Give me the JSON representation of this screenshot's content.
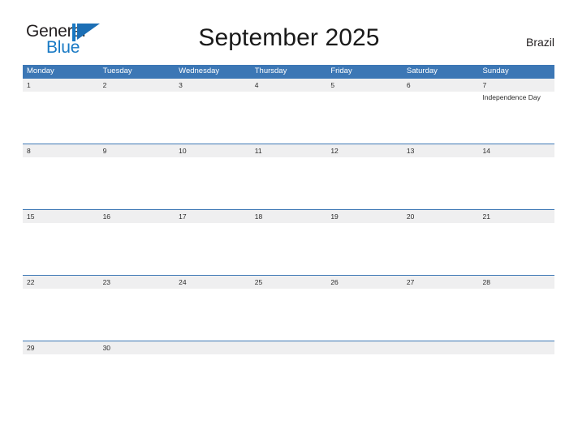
{
  "brand": {
    "line1": "General",
    "line2": "Blue",
    "mark": "flag-triangle-icon",
    "color_dark": "#231f20",
    "color_blue": "#1879c4"
  },
  "header": {
    "title": "September 2025",
    "country": "Brazil"
  },
  "theme": {
    "header_blue": "#3c77b5",
    "date_band": "#efeff0",
    "text": "#2b2b2b"
  },
  "calendar": {
    "weekdays": [
      "Monday",
      "Tuesday",
      "Wednesday",
      "Thursday",
      "Friday",
      "Saturday",
      "Sunday"
    ],
    "weeks": [
      {
        "days": [
          {
            "num": "1",
            "events": []
          },
          {
            "num": "2",
            "events": []
          },
          {
            "num": "3",
            "events": []
          },
          {
            "num": "4",
            "events": []
          },
          {
            "num": "5",
            "events": []
          },
          {
            "num": "6",
            "events": []
          },
          {
            "num": "7",
            "events": [
              "Independence Day"
            ]
          }
        ]
      },
      {
        "days": [
          {
            "num": "8",
            "events": []
          },
          {
            "num": "9",
            "events": []
          },
          {
            "num": "10",
            "events": []
          },
          {
            "num": "11",
            "events": []
          },
          {
            "num": "12",
            "events": []
          },
          {
            "num": "13",
            "events": []
          },
          {
            "num": "14",
            "events": []
          }
        ]
      },
      {
        "days": [
          {
            "num": "15",
            "events": []
          },
          {
            "num": "16",
            "events": []
          },
          {
            "num": "17",
            "events": []
          },
          {
            "num": "18",
            "events": []
          },
          {
            "num": "19",
            "events": []
          },
          {
            "num": "20",
            "events": []
          },
          {
            "num": "21",
            "events": []
          }
        ]
      },
      {
        "days": [
          {
            "num": "22",
            "events": []
          },
          {
            "num": "23",
            "events": []
          },
          {
            "num": "24",
            "events": []
          },
          {
            "num": "25",
            "events": []
          },
          {
            "num": "26",
            "events": []
          },
          {
            "num": "27",
            "events": []
          },
          {
            "num": "28",
            "events": []
          }
        ]
      },
      {
        "days": [
          {
            "num": "29",
            "events": []
          },
          {
            "num": "30",
            "events": []
          },
          {
            "num": "",
            "events": []
          },
          {
            "num": "",
            "events": []
          },
          {
            "num": "",
            "events": []
          },
          {
            "num": "",
            "events": []
          },
          {
            "num": "",
            "events": []
          }
        ]
      }
    ]
  }
}
